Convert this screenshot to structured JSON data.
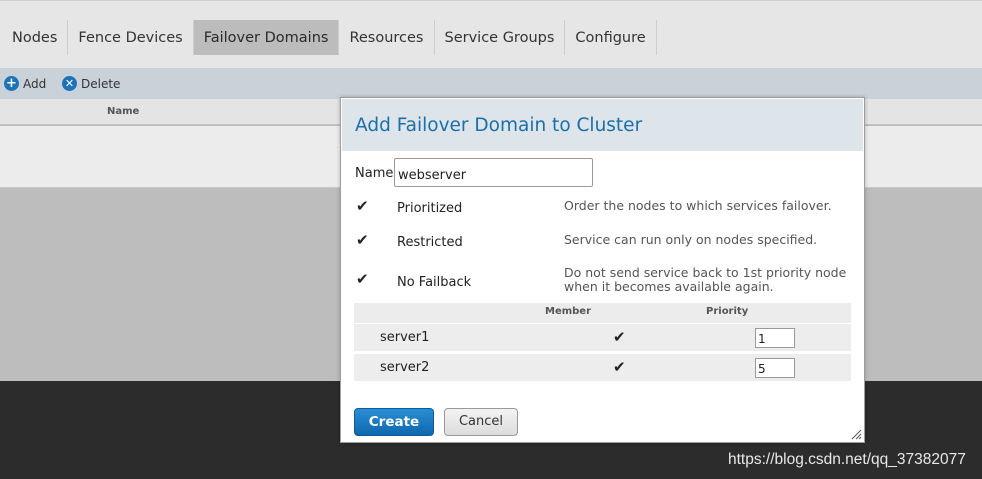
{
  "nav": {
    "tabs": [
      {
        "label": "Nodes"
      },
      {
        "label": "Fence Devices"
      },
      {
        "label": "Failover Domains"
      },
      {
        "label": "Resources"
      },
      {
        "label": "Service Groups"
      },
      {
        "label": "Configure"
      }
    ],
    "active_tab": "Failover Domains"
  },
  "toolbar": {
    "add_label": "Add",
    "delete_label": "Delete"
  },
  "list": {
    "column_name": "Name"
  },
  "dialog": {
    "title": "Add Failover Domain to Cluster",
    "name_label": "Name",
    "name_value": "webserver",
    "options": [
      {
        "label": "Prioritized",
        "checked": true,
        "description": "Order the nodes to which services failover."
      },
      {
        "label": "Restricted",
        "checked": true,
        "description": "Service can run only on nodes specified."
      },
      {
        "label": "No Failback",
        "checked": true,
        "description": "Do not send service back to 1st priority node when it becomes available again."
      }
    ],
    "members_table": {
      "headers": {
        "member": "Member",
        "priority": "Priority"
      },
      "rows": [
        {
          "server": "server1",
          "member": true,
          "priority": "1"
        },
        {
          "server": "server2",
          "member": true,
          "priority": "5"
        }
      ]
    },
    "create_label": "Create",
    "cancel_label": "Cancel"
  },
  "watermark": "https://blog.csdn.net/qq_37382077",
  "colors": {
    "accent": "#1a6fa8",
    "primary_button": "#1673bd",
    "title_bar": "#dee5ea"
  }
}
